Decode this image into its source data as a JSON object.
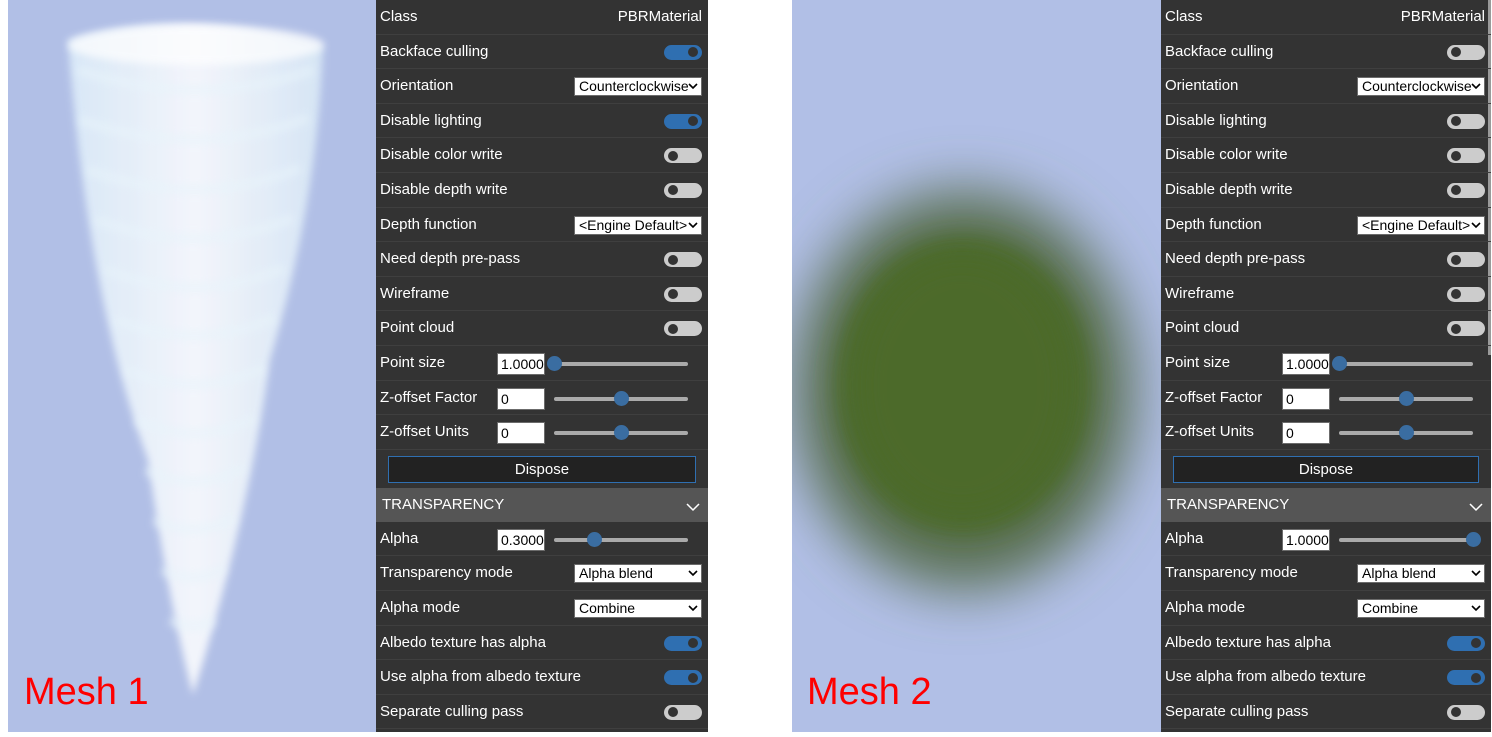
{
  "meshes": [
    {
      "label": "Mesh 1"
    },
    {
      "label": "Mesh 2"
    }
  ],
  "panels": [
    {
      "rows": [
        {
          "type": "text",
          "label": "Class",
          "value": "PBRMaterial"
        },
        {
          "type": "toggle",
          "label": "Backface culling",
          "on": true
        },
        {
          "type": "select",
          "label": "Orientation",
          "value": "Counterclockwise"
        },
        {
          "type": "toggle",
          "label": "Disable lighting",
          "on": true
        },
        {
          "type": "toggle",
          "label": "Disable color write",
          "on": false
        },
        {
          "type": "toggle",
          "label": "Disable depth write",
          "on": false
        },
        {
          "type": "select",
          "label": "Depth function",
          "value": "<Engine Default>"
        },
        {
          "type": "toggle",
          "label": "Need depth pre-pass",
          "on": false
        },
        {
          "type": "toggle",
          "label": "Wireframe",
          "on": false
        },
        {
          "type": "toggle",
          "label": "Point cloud",
          "on": false
        },
        {
          "type": "slider",
          "label": "Point size",
          "value": "1.0000",
          "fraction": 0.0
        },
        {
          "type": "slider",
          "label": "Z-offset Factor",
          "value": "0",
          "fraction": 0.5
        },
        {
          "type": "slider",
          "label": "Z-offset Units",
          "value": "0",
          "fraction": 0.5
        },
        {
          "type": "button",
          "label": "Dispose"
        },
        {
          "type": "section",
          "label": "TRANSPARENCY"
        },
        {
          "type": "slider",
          "label": "Alpha",
          "value": "0.3000",
          "fraction": 0.3
        },
        {
          "type": "select",
          "label": "Transparency mode",
          "value": "Alpha blend"
        },
        {
          "type": "select",
          "label": "Alpha mode",
          "value": "Combine"
        },
        {
          "type": "toggle",
          "label": "Albedo texture has alpha",
          "on": true
        },
        {
          "type": "toggle",
          "label": "Use alpha from albedo texture",
          "on": true
        },
        {
          "type": "toggle",
          "label": "Separate culling pass",
          "on": false
        }
      ]
    },
    {
      "rows": [
        {
          "type": "text",
          "label": "Class",
          "value": "PBRMaterial"
        },
        {
          "type": "toggle",
          "label": "Backface culling",
          "on": false
        },
        {
          "type": "select",
          "label": "Orientation",
          "value": "Counterclockwise"
        },
        {
          "type": "toggle",
          "label": "Disable lighting",
          "on": false
        },
        {
          "type": "toggle",
          "label": "Disable color write",
          "on": false
        },
        {
          "type": "toggle",
          "label": "Disable depth write",
          "on": false
        },
        {
          "type": "select",
          "label": "Depth function",
          "value": "<Engine Default>"
        },
        {
          "type": "toggle",
          "label": "Need depth pre-pass",
          "on": false
        },
        {
          "type": "toggle",
          "label": "Wireframe",
          "on": false
        },
        {
          "type": "toggle",
          "label": "Point cloud",
          "on": false
        },
        {
          "type": "slider",
          "label": "Point size",
          "value": "1.0000",
          "fraction": 0.0
        },
        {
          "type": "slider",
          "label": "Z-offset Factor",
          "value": "0",
          "fraction": 0.5
        },
        {
          "type": "slider",
          "label": "Z-offset Units",
          "value": "0",
          "fraction": 0.5
        },
        {
          "type": "button",
          "label": "Dispose"
        },
        {
          "type": "section",
          "label": "TRANSPARENCY"
        },
        {
          "type": "slider",
          "label": "Alpha",
          "value": "1.0000",
          "fraction": 1.0
        },
        {
          "type": "select",
          "label": "Transparency mode",
          "value": "Alpha blend"
        },
        {
          "type": "select",
          "label": "Alpha mode",
          "value": "Combine"
        },
        {
          "type": "toggle",
          "label": "Albedo texture has alpha",
          "on": true
        },
        {
          "type": "toggle",
          "label": "Use alpha from albedo texture",
          "on": true
        },
        {
          "type": "toggle",
          "label": "Separate culling pass",
          "on": false
        }
      ]
    }
  ],
  "colors": {
    "viewport_bg": "#b1bfe6",
    "panel_bg": "#333333",
    "accent": "#2f6fb1",
    "mesh_label": "#ff0000"
  }
}
